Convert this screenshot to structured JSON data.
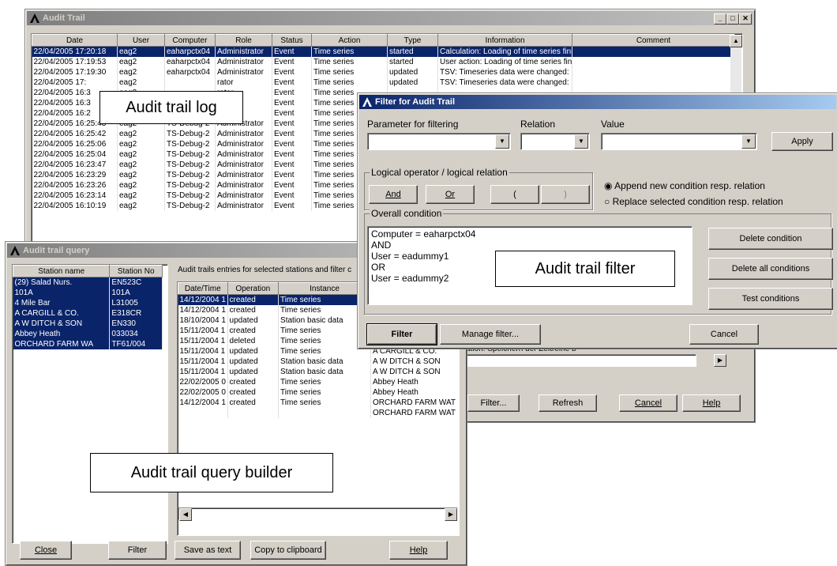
{
  "audit_trail": {
    "title": "Audit Trail",
    "columns": [
      "Date",
      "User",
      "Computer",
      "Role",
      "Status",
      "Action",
      "Type",
      "Information",
      "Comment"
    ],
    "rows": [
      [
        "22/04/2005 17:20:18",
        "eag2",
        "eaharpctx04",
        "Administrator",
        "Event",
        "Time series",
        "started",
        "Calculation: Loading of time series fini",
        ""
      ],
      [
        "22/04/2005 17:19:53",
        "eag2",
        "eaharpctx04",
        "Administrator",
        "Event",
        "Time series",
        "started",
        "User action: Loading of time series fini",
        ""
      ],
      [
        "22/04/2005 17:19:30",
        "eag2",
        "eaharpctx04",
        "Administrator",
        "Event",
        "Time series",
        "updated",
        "TSV: Timeseries data were changed:",
        ""
      ],
      [
        "22/04/2005 17:",
        "eag2",
        "",
        "rator",
        "Event",
        "Time series",
        "updated",
        "TSV: Timeseries data were changed:",
        ""
      ],
      [
        "22/04/2005 16:3",
        "eag2",
        "",
        "rator",
        "Event",
        "Time series",
        "",
        "",
        ""
      ],
      [
        "22/04/2005 16:3",
        "",
        "",
        "rator",
        "Event",
        "Time series",
        "",
        "",
        ""
      ],
      [
        "22/04/2005 16:2",
        "",
        "",
        "rator",
        "Event",
        "Time series",
        "",
        "",
        ""
      ],
      [
        "22/04/2005 16:25:43",
        "eag2",
        "TS-Debug-2",
        "Administrator",
        "Event",
        "Time series",
        "",
        "",
        ""
      ],
      [
        "22/04/2005 16:25:42",
        "eag2",
        "TS-Debug-2",
        "Administrator",
        "Event",
        "Time series",
        "",
        "",
        ""
      ],
      [
        "22/04/2005 16:25:06",
        "eag2",
        "TS-Debug-2",
        "Administrator",
        "Event",
        "Time series",
        "",
        "",
        ""
      ],
      [
        "22/04/2005 16:25:04",
        "eag2",
        "TS-Debug-2",
        "Administrator",
        "Event",
        "Time series",
        "",
        "",
        ""
      ],
      [
        "22/04/2005 16:23:47",
        "eag2",
        "TS-Debug-2",
        "Administrator",
        "Event",
        "Time series",
        "",
        "",
        ""
      ],
      [
        "22/04/2005 16:23:29",
        "eag2",
        "TS-Debug-2",
        "Administrator",
        "Event",
        "Time series",
        "",
        "",
        ""
      ],
      [
        "22/04/2005 16:23:26",
        "eag2",
        "TS-Debug-2",
        "Administrator",
        "Event",
        "Time series",
        "",
        "",
        ""
      ],
      [
        "22/04/2005 16:23:14",
        "eag2",
        "TS-Debug-2",
        "Administrator",
        "Event",
        "Time series",
        "",
        "",
        ""
      ],
      [
        "22/04/2005 16:10:19",
        "eag2",
        "TS-Debug-2",
        "Administrator",
        "Event",
        "Time series",
        "",
        "",
        ""
      ]
    ],
    "hidden_info": "ation: Speichern der Zeitreihe b",
    "buttons": {
      "filter": "Filter...",
      "refresh": "Refresh",
      "cancel": "Cancel",
      "help": "Help"
    }
  },
  "query": {
    "title": "Audit trail query",
    "station_columns": [
      "Station name",
      "Station No"
    ],
    "stations": [
      [
        "(29) Salad Nurs.",
        "EN523C"
      ],
      [
        "101A",
        "101A"
      ],
      [
        "4 Mile Bar",
        "L31005"
      ],
      [
        "A CARGILL & CO.",
        "E318CR"
      ],
      [
        "A W DITCH & SON",
        "EN330"
      ],
      [
        "Abbey Heath",
        "033034"
      ],
      [
        "ORCHARD FARM WA",
        "TF61/004"
      ]
    ],
    "entries_label": "Audit trails entries for selected stations and filter c",
    "entry_columns": [
      "Date/Time",
      "Operation",
      "Instance",
      ""
    ],
    "entries": [
      [
        "14/12/2004 1",
        "created",
        "Time series",
        ""
      ],
      [
        "14/12/2004 1",
        "created",
        "Time series",
        ""
      ],
      [
        "18/10/2004 1",
        "updated",
        "Station basic data",
        ""
      ],
      [
        "15/11/2004 1",
        "created",
        "Time series",
        ""
      ],
      [
        "15/11/2004 1",
        "deleted",
        "Time series",
        "4 Mile Bar"
      ],
      [
        "15/11/2004 1",
        "updated",
        "Time series",
        "A CARGILL & CO."
      ],
      [
        "15/11/2004 1",
        "updated",
        "Station basic data",
        "A W DITCH & SON"
      ],
      [
        "15/11/2004 1",
        "updated",
        "Station basic data",
        "A W DITCH & SON"
      ],
      [
        "22/02/2005 0",
        "created",
        "Time series",
        "Abbey Heath"
      ],
      [
        "22/02/2005 0",
        "created",
        "Time series",
        "Abbey Heath"
      ],
      [
        "14/12/2004 1",
        "created",
        "Time series",
        "ORCHARD FARM WAT"
      ],
      [
        "",
        "",
        "",
        "ORCHARD FARM WAT"
      ]
    ],
    "buttons": {
      "close": "Close",
      "filter": "Filter",
      "save": "Save as text",
      "copy": "Copy to clipboard",
      "help": "Help"
    }
  },
  "filter": {
    "title": "Filter for Audit Trail",
    "param_label": "Parameter for filtering",
    "relation_label": "Relation",
    "value_label": "Value",
    "apply": "Apply",
    "logical_group": "Logical operator / logical relation",
    "and": "And",
    "or": "Or",
    "lparen": "(",
    "rparen": ")",
    "radio_append": "Append new condition resp. relation",
    "radio_replace": "Replace selected condition resp. relation",
    "overall_label": "Overall condition",
    "conditions": [
      "Computer = eaharpctx04",
      "AND",
      "User = eadummy1",
      "OR",
      "User = eadummy2"
    ],
    "delete_condition": "Delete condition",
    "delete_all": "Delete all conditions",
    "test": "Test conditions",
    "filter_btn": "Filter",
    "manage": "Manage filter...",
    "cancel": "Cancel"
  },
  "callouts": {
    "log": "Audit trail log",
    "filter": "Audit trail filter",
    "builder": "Audit trail query builder"
  }
}
